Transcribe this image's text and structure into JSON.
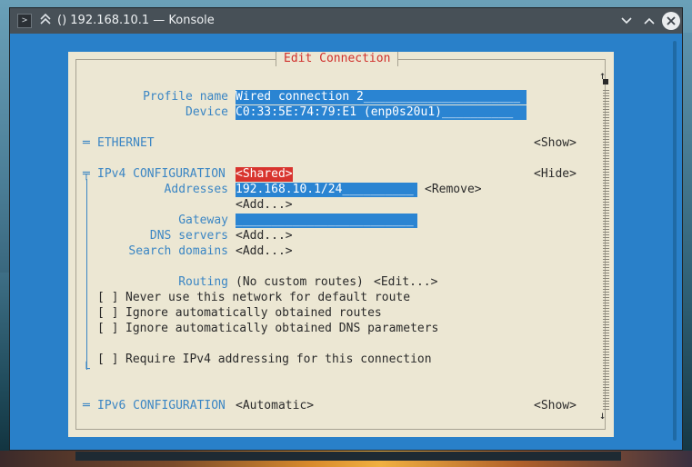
{
  "window": {
    "title": "() 192.168.10.1 — Konsole",
    "app_icon": ">",
    "minimize_icon": "chevron-down-icon",
    "maximize_icon": "chevron-up-icon",
    "close_icon": "close-icon"
  },
  "dialog": {
    "title": "Edit Connection",
    "profile_name_label": "Profile name",
    "profile_name_value": "Wired connection 2______________________",
    "device_label": "Device",
    "device_value": "C0:33:5E:74:79:E1 (enp0s20u1)__________",
    "ethernet": {
      "marker": "═",
      "label": "ETHERNET",
      "toggle": "<Show>"
    },
    "ipv4": {
      "marker": "╤",
      "label": "IPv4 CONFIGURATION",
      "mode": "<Shared>",
      "toggle": "<Hide>",
      "addresses_label": "Addresses",
      "address_value": "192.168.10.1/24__________",
      "remove_button": "<Remove>",
      "add_address_button": "<Add...>",
      "gateway_label": "Gateway",
      "gateway_value": "_________________________",
      "dns_label": "DNS servers",
      "dns_add_button": "<Add...>",
      "search_label": "Search domains",
      "search_add_button": "<Add...>",
      "routing_label": "Routing",
      "routing_value": "(No custom routes)",
      "routing_edit_button": "<Edit...>",
      "checkboxes": [
        {
          "box": "[ ]",
          "label": "Never use this network for default route"
        },
        {
          "box": "[ ]",
          "label": "Ignore automatically obtained routes"
        },
        {
          "box": "[ ]",
          "label": "Ignore automatically obtained DNS parameters"
        }
      ],
      "require_checkbox": {
        "box": "[ ]",
        "label": "Require IPv4 addressing for this connection"
      },
      "end_marker": "└"
    },
    "ipv6": {
      "marker": "═",
      "label": "IPv6 CONFIGURATION",
      "mode": "<Automatic>",
      "toggle": "<Show>"
    },
    "scroll_up": "↑",
    "scroll_down": "↓"
  }
}
